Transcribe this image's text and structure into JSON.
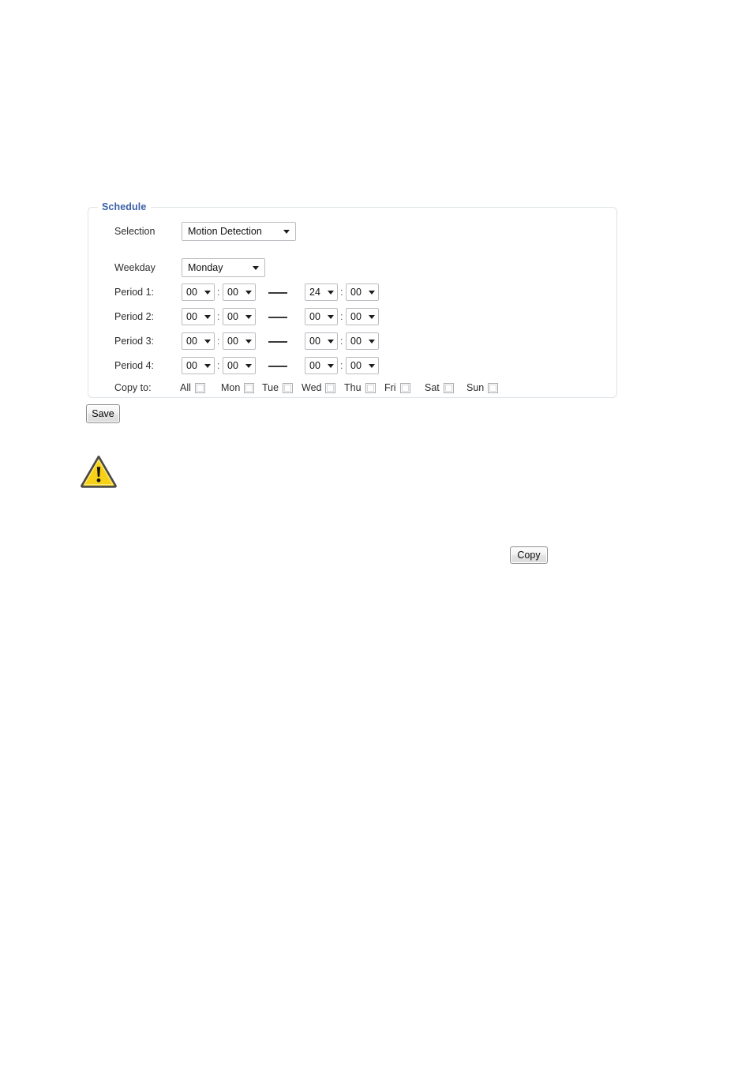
{
  "panel": {
    "legend": "Schedule",
    "selection": {
      "label": "Selection",
      "value": "Motion Detection"
    },
    "weekday": {
      "label": "Weekday",
      "value": "Monday"
    },
    "periods": [
      {
        "label": "Period 1:",
        "start_hour": "00",
        "start_min": "00",
        "end_hour": "24",
        "end_min": "00"
      },
      {
        "label": "Period 2:",
        "start_hour": "00",
        "start_min": "00",
        "end_hour": "00",
        "end_min": "00"
      },
      {
        "label": "Period 3:",
        "start_hour": "00",
        "start_min": "00",
        "end_hour": "00",
        "end_min": "00"
      },
      {
        "label": "Period 4:",
        "start_hour": "00",
        "start_min": "00",
        "end_hour": "00",
        "end_min": "00"
      }
    ],
    "time_separator": ":",
    "copy_to": {
      "label": "Copy to:",
      "days": [
        {
          "label": "All",
          "checked": false
        },
        {
          "label": "Mon",
          "checked": false
        },
        {
          "label": "Tue",
          "checked": false
        },
        {
          "label": "Wed",
          "checked": false
        },
        {
          "label": "Thu",
          "checked": false
        },
        {
          "label": "Fri",
          "checked": false
        },
        {
          "label": "Sat",
          "checked": false
        },
        {
          "label": "Sun",
          "checked": false
        }
      ],
      "copy_button": "Copy"
    }
  },
  "save_button": "Save",
  "warning_icon": "warning-triangle-icon",
  "colors": {
    "legend_blue": "#3c62a8",
    "panel_border": "#dde3e8",
    "warning_fill": "#f5d020",
    "warning_border": "#4a4a4a"
  }
}
